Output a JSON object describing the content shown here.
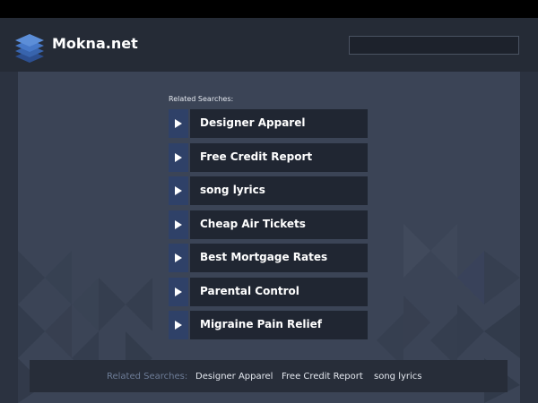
{
  "header": {
    "site_name": "Mokna.net",
    "search_value": "",
    "logo_icon": "stacked-layers-icon"
  },
  "main": {
    "related_label": "Related Searches:",
    "links": [
      {
        "label": "Designer Apparel",
        "icon": "play-arrow-icon"
      },
      {
        "label": "Free Credit Report",
        "icon": "play-arrow-icon"
      },
      {
        "label": "song lyrics",
        "icon": "play-arrow-icon"
      },
      {
        "label": "Cheap Air Tickets",
        "icon": "play-arrow-icon"
      },
      {
        "label": "Best Mortgage Rates",
        "icon": "play-arrow-icon"
      },
      {
        "label": "Parental Control",
        "icon": "play-arrow-icon"
      },
      {
        "label": "Migraine Pain Relief",
        "icon": "play-arrow-icon"
      }
    ]
  },
  "footer": {
    "related_label": "Related Searches:",
    "links": [
      "Designer Apparel",
      "Free Credit Report",
      "song lyrics"
    ]
  },
  "colors": {
    "page_background": "#2b3240",
    "header_background": "#252b36",
    "panel_background": "#3b4456",
    "arrow_box": "#2f4168",
    "link_box": "#202632",
    "footer_label": "#6d7c97"
  }
}
